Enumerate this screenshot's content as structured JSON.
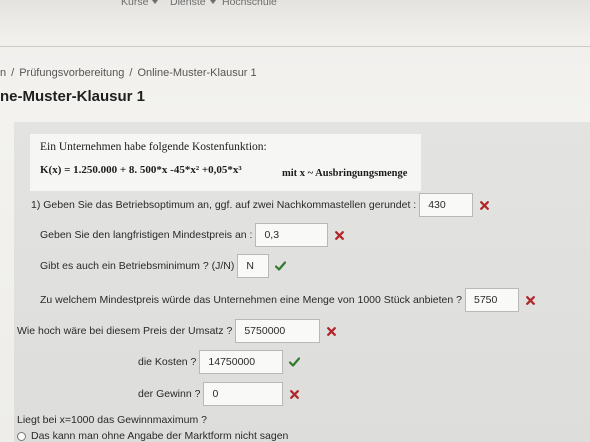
{
  "topnav": {
    "items": [
      {
        "label": "Kurse",
        "icon": "chevron-down-icon"
      },
      {
        "label": "Dienste",
        "icon": "chevron-down-icon"
      },
      {
        "label": "Hochschule"
      }
    ]
  },
  "breadcrumb": {
    "separator": "/",
    "items": [
      "n",
      "Prüfungsvorbereitung",
      "Online-Muster-Klausur 1"
    ]
  },
  "page_title": "ne-Muster-Klausur 1",
  "problem": {
    "intro": "Ein Unternehmen habe folgende Kostenfunktion:",
    "cost_function": "K(x) = 1.250.000 + 8. 500*x -45*x² +0,05*x³",
    "variable_note": "mit x ~ Ausbringungsmenge"
  },
  "questions": [
    {
      "label": "1) Geben Sie das Betriebsoptimum an, ggf. auf zwei Nachkommastellen gerundet :",
      "value": "430",
      "status": "incorrect"
    },
    {
      "label": "Geben Sie den langfristigen Mindestpreis an :",
      "value": "0,3",
      "status": "incorrect"
    },
    {
      "label": "Gibt es auch ein Betriebsminimum ? (J/N)",
      "value": "N",
      "status": "correct"
    },
    {
      "label": "Zu welchem Mindestpreis würde das Unternehmen eine Menge von 1000 Stück anbieten ?",
      "value": "5750",
      "status": "incorrect"
    },
    {
      "label": "Wie hoch wäre bei diesem Preis der Umsatz ?",
      "value": "5750000",
      "status": "incorrect"
    },
    {
      "label": "die Kosten ?",
      "value": "14750000",
      "status": "correct"
    },
    {
      "label": "der Gewinn ?",
      "value": "0",
      "status": "incorrect"
    }
  ],
  "choice_question": {
    "label": "Liegt bei x=1000 das Gewinnmaximum ?",
    "options": [
      "Das kann man ohne Angabe der Marktform nicht sagen"
    ]
  },
  "icons": {
    "correct": "check-icon",
    "incorrect": "cross-icon"
  },
  "colors": {
    "correct": "#2f7a2c",
    "incorrect": "#b0262a"
  }
}
